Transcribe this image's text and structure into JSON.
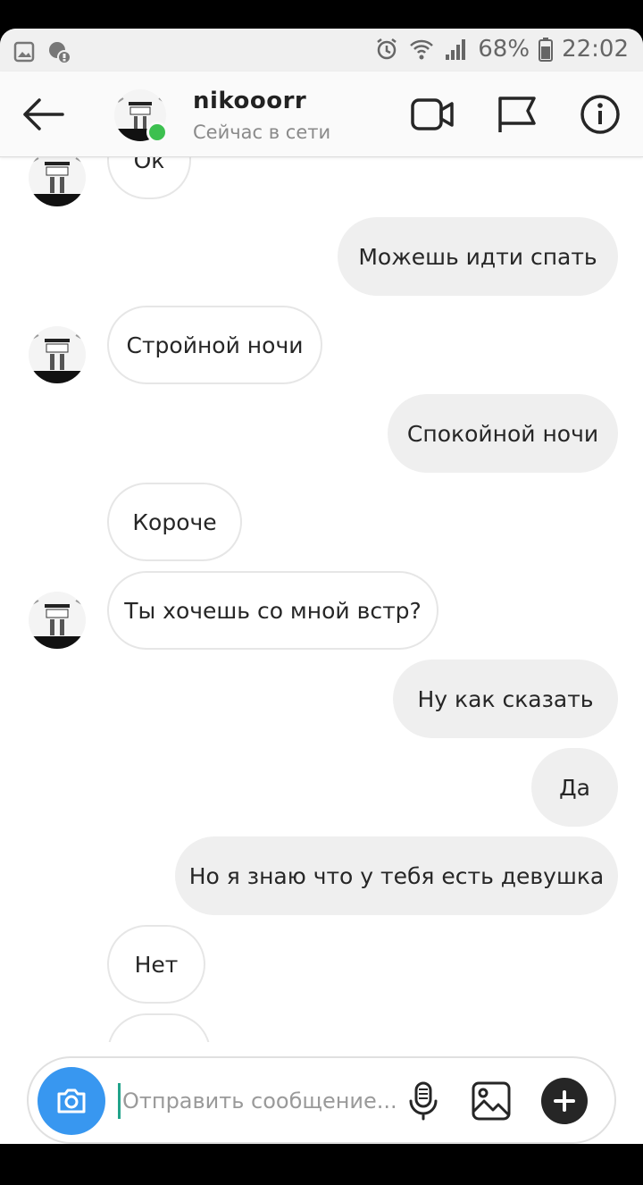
{
  "status_bar": {
    "battery": "68%",
    "time": "22:02"
  },
  "header": {
    "username": "nikooorr",
    "presence": "Сейчас в сети"
  },
  "messages": [
    {
      "side": "in",
      "text": "Ок"
    },
    {
      "side": "out",
      "text": "Можешь идти спать"
    },
    {
      "side": "in",
      "text": "Стройной ночи"
    },
    {
      "side": "out",
      "text": "Спокойной ночи"
    },
    {
      "side": "in",
      "text": "Короче"
    },
    {
      "side": "in",
      "text": "Ты хочешь со мной встр?"
    },
    {
      "side": "out",
      "text": "Ну как сказать"
    },
    {
      "side": "out",
      "text": "Да"
    },
    {
      "side": "out",
      "text": "Но я знаю что у тебя есть девушка"
    },
    {
      "side": "in",
      "text": "Нет"
    },
    {
      "side": "in",
      "text": ""
    }
  ],
  "composer": {
    "placeholder": "Отправить сообщение..."
  },
  "colors": {
    "accent": "#3897f0",
    "online": "#3cc04f",
    "outgoing_bubble": "#efefef"
  }
}
